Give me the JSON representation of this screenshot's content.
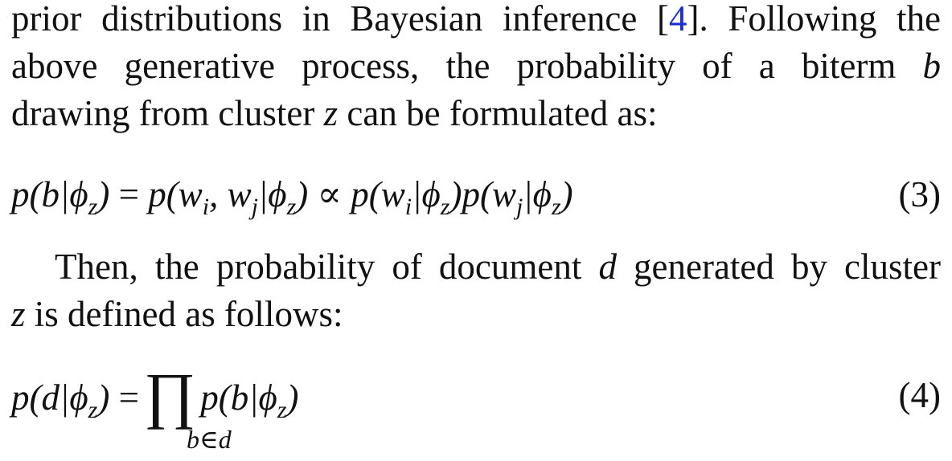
{
  "paragraph1": {
    "line1_text": "prior distributions in Bayesian inference [",
    "line1_cite": "4",
    "line1_after": "]. Following the",
    "line2_text": "above generative process, the probability of a biterm ",
    "line2_var": "b",
    "line3_pre": "drawing from cluster ",
    "line3_var": "z",
    "line3_post": " can be formulated as:"
  },
  "equation3": {
    "number": "(3)"
  },
  "paragraph2": {
    "line1_pre": "Then, the probability of document ",
    "line1_var": "d",
    "line1_post": " generated by cluster",
    "line2_var": "z",
    "line2_post": " is defined as follows:"
  },
  "equation4": {
    "number": "(4)",
    "product_subscript": "b∈d"
  }
}
